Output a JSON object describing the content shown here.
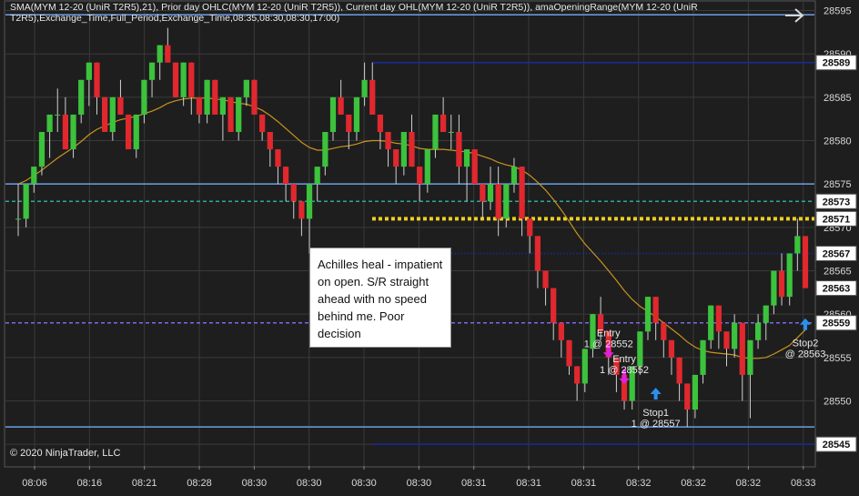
{
  "indicator_label": "SMA(MYM 12-20 (UniR T2R5),21), Prior day OHLC(MYM 12-20 (UniR T2R5)), Current day OHL(MYM 12-20 (UniR T2R5)), amaOpeningRange(MYM 12-20 (UniR T2R5),Exchange_Time,Full_Period,Exchange_Time,08:35,08:30,08:30,17:00)",
  "copyright": "© 2020 NinjaTrader, LLC",
  "annotation_text": "Achilles heal - impatient on open. S/R straight ahead with no speed behind me. Poor decision",
  "icons": {
    "nav": "arrow-right-icon"
  },
  "colors": {
    "background": "#1e1e1e",
    "grid": "#3a3a3a",
    "up_bar": "#3cc23c",
    "down_bar": "#e0282e",
    "sma": "#c8941e",
    "level_blue_dark": "#1a2a9a",
    "level_blue_light": "#6aa0e8",
    "level_teal": "#2aa8a0",
    "level_yellow": "#f0d020",
    "level_purple": "#7a6ae8",
    "marker_magenta": "#e020e0",
    "marker_blue": "#2a90f0",
    "price_box": "#ffffff"
  },
  "chart_data": {
    "type": "candlestick",
    "instrument": "MYM 12-20 (UniR T2R5)",
    "y_ticks": [
      28545,
      28550,
      28555,
      28560,
      28565,
      28570,
      28575,
      28580,
      28585,
      28590,
      28595
    ],
    "ylim": [
      28542.5,
      28596
    ],
    "x_ticks": [
      "08:06",
      "08:16",
      "08:21",
      "08:28",
      "08:30",
      "08:30",
      "08:30",
      "08:30",
      "08:31",
      "08:31",
      "08:31",
      "08:32",
      "08:32",
      "08:32",
      "08:33"
    ],
    "grid": true,
    "price_markers": [
      28589,
      28573,
      28571,
      28567,
      28563,
      28559,
      28545
    ],
    "levels": [
      {
        "value": 28594.5,
        "style": "solid",
        "color": "level_blue_light",
        "from_bar": 0
      },
      {
        "value": 28589,
        "style": "solid",
        "color": "level_blue_dark",
        "from_bar": 43
      },
      {
        "value": 28575,
        "style": "solid",
        "color": "level_blue_light",
        "from_bar": 0
      },
      {
        "value": 28573,
        "style": "dashed",
        "color": "level_teal",
        "from_bar": 0
      },
      {
        "value": 28571,
        "style": "dotted-thick",
        "color": "level_yellow",
        "from_bar": 43
      },
      {
        "value": 28567,
        "style": "dotted",
        "color": "level_blue_dark",
        "from_bar": 43
      },
      {
        "value": 28559,
        "style": "dashed",
        "color": "level_purple",
        "from_bar": 0
      },
      {
        "value": 28547,
        "style": "solid",
        "color": "level_blue_light",
        "from_bar": 0
      },
      {
        "value": 28545,
        "style": "solid",
        "color": "level_blue_dark",
        "from_bar": 43
      }
    ],
    "bars_ohlc": [
      [
        28571,
        28575,
        28569,
        28571
      ],
      [
        28571,
        28575,
        28570,
        28575
      ],
      [
        28575,
        28577,
        28574,
        28577
      ],
      [
        28577,
        28581,
        28576,
        28581
      ],
      [
        28581,
        28583,
        28578,
        28583
      ],
      [
        28583,
        28586,
        28581,
        28583
      ],
      [
        28583,
        28585,
        28579,
        28579
      ],
      [
        28579,
        28583,
        28578,
        28583
      ],
      [
        28583,
        28587,
        28582,
        28587
      ],
      [
        28587,
        28589,
        28584,
        28589
      ],
      [
        28589,
        28589,
        28583,
        28585
      ],
      [
        28585,
        28585,
        28581,
        28581
      ],
      [
        28581,
        28585,
        28580,
        28585
      ],
      [
        28585,
        28587,
        28583,
        28583
      ],
      [
        28583,
        28583,
        28580,
        28579
      ],
      [
        28579,
        28583,
        28578,
        28583
      ],
      [
        28583,
        28587,
        28582,
        28587
      ],
      [
        28587,
        28589,
        28585,
        28589
      ],
      [
        28589,
        28591,
        28587,
        28591
      ],
      [
        28591,
        28593,
        28589,
        28589
      ],
      [
        28589,
        28589,
        28585,
        28585
      ],
      [
        28585,
        28589,
        28584,
        28589
      ],
      [
        28589,
        28589,
        28583,
        28585
      ],
      [
        28585,
        28585,
        28582,
        28583
      ],
      [
        28583,
        28587,
        28582,
        28587
      ],
      [
        28587,
        28587,
        28583,
        28583
      ],
      [
        28583,
        28585,
        28580,
        28585
      ],
      [
        28585,
        28585,
        28581,
        28581
      ],
      [
        28581,
        28585,
        28580,
        28585
      ],
      [
        28585,
        28587,
        28584,
        28587
      ],
      [
        28587,
        28587,
        28583,
        28583
      ],
      [
        28583,
        28583,
        28580,
        28581
      ],
      [
        28581,
        28581,
        28577,
        28579
      ],
      [
        28579,
        28579,
        28575,
        28577
      ],
      [
        28577,
        28577,
        28573,
        28575
      ],
      [
        28575,
        28575,
        28571,
        28573
      ],
      [
        28573,
        28573,
        28569,
        28571
      ],
      [
        28571,
        28575,
        28567,
        28575
      ],
      [
        28575,
        28577,
        28573,
        28577
      ],
      [
        28577,
        28581,
        28576,
        28581
      ],
      [
        28581,
        28585,
        28580,
        28585
      ],
      [
        28585,
        28587,
        28583,
        28583
      ],
      [
        28583,
        28583,
        28579,
        28581
      ],
      [
        28581,
        28585,
        28580,
        28585
      ],
      [
        28585,
        28589,
        28584,
        28587
      ],
      [
        28587,
        28589,
        28583,
        28583
      ],
      [
        28583,
        28583,
        28579,
        28581
      ],
      [
        28581,
        28581,
        28577,
        28579
      ],
      [
        28579,
        28579,
        28575,
        28577
      ],
      [
        28577,
        28581,
        28576,
        28581
      ],
      [
        28581,
        28583,
        28577,
        28577
      ],
      [
        28577,
        28577,
        28573,
        28575
      ],
      [
        28575,
        28579,
        28574,
        28579
      ],
      [
        28579,
        28583,
        28578,
        28583
      ],
      [
        28583,
        28585,
        28581,
        28581
      ],
      [
        28581,
        28583,
        28579,
        28581
      ],
      [
        28581,
        28583,
        28575,
        28577
      ],
      [
        28577,
        28579,
        28573,
        28579
      ],
      [
        28579,
        28579,
        28575,
        28575
      ],
      [
        28575,
        28575,
        28571,
        28573
      ],
      [
        28573,
        28577,
        28572,
        28575
      ],
      [
        28575,
        28577,
        28569,
        28571
      ],
      [
        28571,
        28575,
        28570,
        28575
      ],
      [
        28575,
        28578,
        28574,
        28577
      ],
      [
        28577,
        28577,
        28569,
        28571
      ],
      [
        28571,
        28571,
        28567,
        28569
      ],
      [
        28569,
        28569,
        28563,
        28565
      ],
      [
        28565,
        28565,
        28561,
        28563
      ],
      [
        28563,
        28563,
        28557,
        28559
      ],
      [
        28559,
        28559,
        28555,
        28557
      ],
      [
        28557,
        28557,
        28553,
        28554
      ],
      [
        28554,
        28554,
        28550,
        28552
      ],
      [
        28552,
        28556,
        28551,
        28556
      ],
      [
        28556,
        28560,
        28555,
        28560
      ],
      [
        28560,
        28562,
        28557,
        28558
      ],
      [
        28558,
        28558,
        28553,
        28555
      ],
      [
        28555,
        28555,
        28551,
        28553
      ],
      [
        28553,
        28553,
        28549,
        28550
      ],
      [
        28550,
        28554,
        28549,
        28554
      ],
      [
        28554,
        28558,
        28553,
        28558
      ],
      [
        28558,
        28562,
        28557,
        28562
      ],
      [
        28562,
        28562,
        28557,
        28559
      ],
      [
        28559,
        28559,
        28555,
        28557
      ],
      [
        28557,
        28557,
        28553,
        28555
      ],
      [
        28555,
        28555,
        28550,
        28552
      ],
      [
        28552,
        28552,
        28547,
        28549
      ],
      [
        28549,
        28553,
        28548,
        28553
      ],
      [
        28553,
        28557,
        28552,
        28557
      ],
      [
        28557,
        28561,
        28556,
        28561
      ],
      [
        28561,
        28561,
        28556,
        28558
      ],
      [
        28558,
        28558,
        28554,
        28556
      ],
      [
        28556,
        28560,
        28555,
        28559
      ],
      [
        28559,
        28559,
        28550,
        28553
      ],
      [
        28553,
        28557,
        28548,
        28557
      ],
      [
        28557,
        28560,
        28556,
        28559
      ],
      [
        28559,
        28561,
        28557,
        28561
      ],
      [
        28561,
        28565,
        28560,
        28565
      ],
      [
        28565,
        28567,
        28561,
        28562
      ],
      [
        28562,
        28567,
        28561,
        28567
      ],
      [
        28567,
        28571,
        28565,
        28569
      ],
      [
        28569,
        28569,
        28563,
        28563
      ]
    ],
    "sma_values": [
      28575,
      28575.4,
      28576,
      28576.6,
      28577.3,
      28578,
      28578.6,
      28579.2,
      28579.9,
      28580.7,
      28581.3,
      28581.7,
      28582.1,
      28582.4,
      28582.6,
      28582.8,
      28583.1,
      28583.4,
      28583.8,
      28584.3,
      28584.6,
      28584.8,
      28584.9,
      28584.9,
      28584.9,
      28584.8,
      28584.7,
      28584.5,
      28584.3,
      28584.2,
      28583.9,
      28583.5,
      28582.9,
      28582.2,
      28581.4,
      28580.6,
      28579.8,
      28579.2,
      28578.9,
      28578.9,
      28579.1,
      28579.3,
      28579.4,
      28579.6,
      28579.9,
      28580,
      28580,
      28579.9,
      28579.7,
      28579.6,
      28579.4,
      28579.1,
      28579,
      28579,
      28579,
      28578.9,
      28578.8,
      28578.7,
      28578.5,
      28578.2,
      28577.9,
      28577.5,
      28577.2,
      28577,
      28576.6,
      28576,
      28575.2,
      28574.3,
      28573.2,
      28572,
      28570.7,
      28569.3,
      28568.1,
      28567.1,
      28566.1,
      28565,
      28563.9,
      28562.7,
      28561.7,
      28560.9,
      28560.3,
      28559.7,
      28559,
      28558.3,
      28557.6,
      28556.8,
      28556.2,
      28555.8,
      28555.6,
      28555.5,
      28555.4,
      28555.3,
      28555,
      28554.9,
      28554.9,
      28555,
      28555.4,
      28555.9,
      28556.4,
      28557.3,
      28558.2
    ],
    "annotations": [
      {
        "label": "Entry",
        "sublabel": "1 @ 28552",
        "type": "entry",
        "bar": 75,
        "price": 28556
      },
      {
        "label": "Entry",
        "sublabel": "1 @ 28552",
        "type": "entry",
        "bar": 77,
        "price": 28553
      },
      {
        "label": "Stop1",
        "sublabel": "1 @ 28557",
        "type": "stop",
        "bar": 81,
        "price": 28551
      },
      {
        "label": "Stop2",
        "sublabel": "@ 28563",
        "type": "stop",
        "bar": 100,
        "price": 28559
      }
    ]
  }
}
